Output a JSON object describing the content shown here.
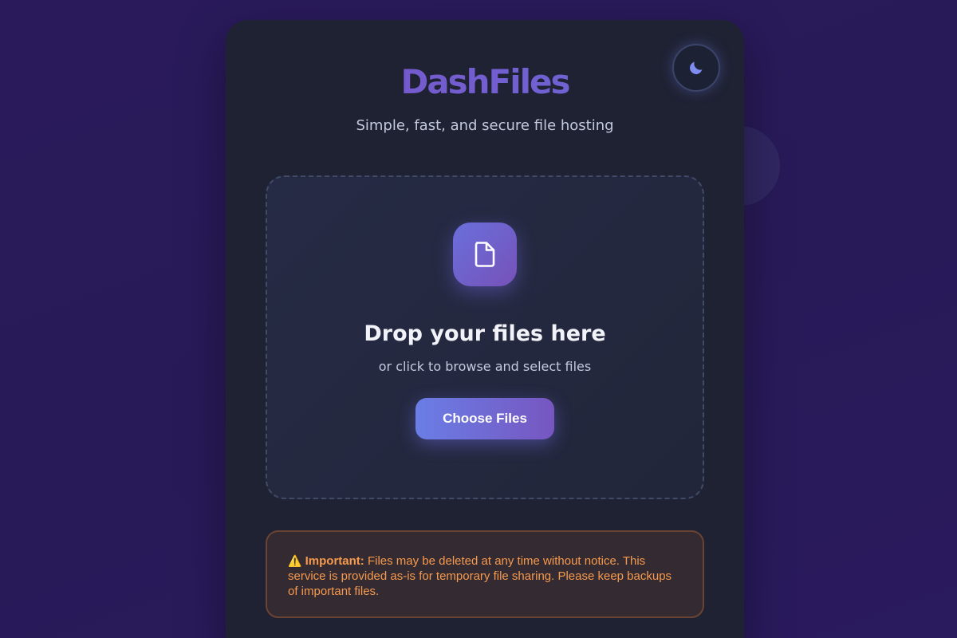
{
  "app": {
    "title": "DashFiles",
    "tagline": "Simple, fast, and secure file hosting"
  },
  "theme_toggle": {
    "icon": "moon-icon"
  },
  "dropzone": {
    "icon": "file-icon",
    "title": "Drop your files here",
    "subtitle": "or click to browse and select files",
    "button_label": "Choose Files"
  },
  "notice": {
    "icon": "warning-icon",
    "icon_glyph": "⚠️",
    "label": "Important:",
    "text": "Files may be deleted at any time without notice. This service is provided as-is for temporary file sharing. Please keep backups of important files."
  },
  "colors": {
    "background": "#2a1a5c",
    "card": "#1f2233",
    "brand": "#6e5cc4",
    "accent_start": "#6a7ee6",
    "accent_end": "#7756c0",
    "warning_text": "#f59a4e",
    "warning_border": "#6b4333"
  }
}
